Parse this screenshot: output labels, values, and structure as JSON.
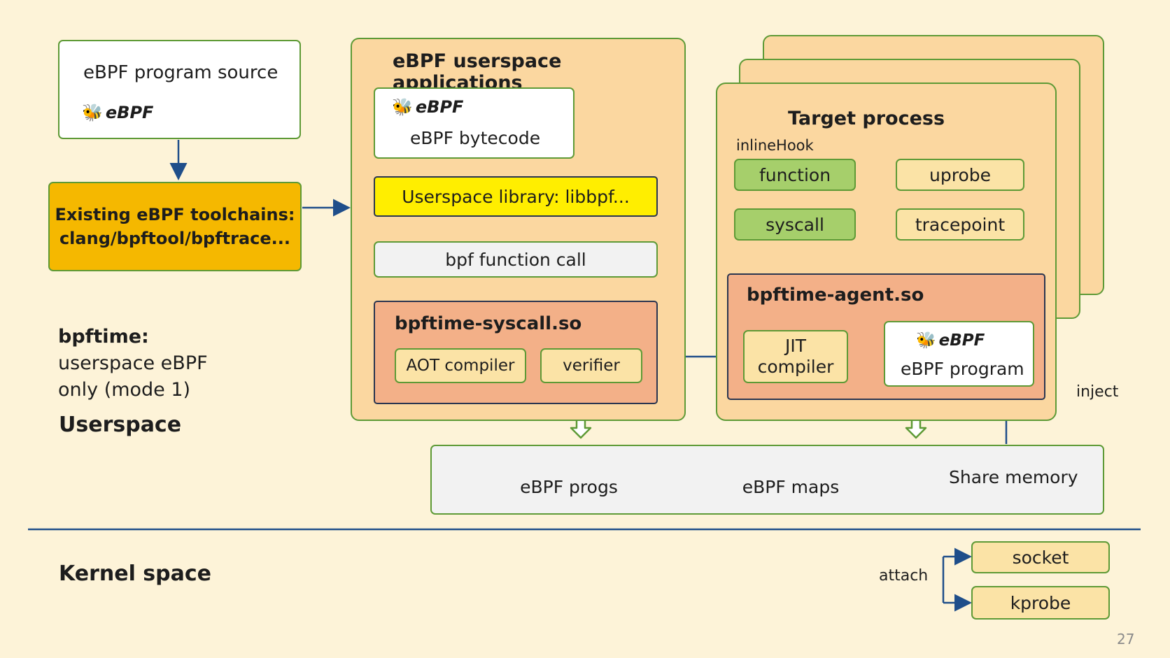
{
  "source": {
    "title": "eBPF program source",
    "logo_text": "eBPF"
  },
  "toolchains": {
    "line1": "Existing eBPF toolchains:",
    "line2": "clang/bpftool/bpftrace..."
  },
  "mode_label": {
    "title": "bpftime:",
    "line1": "userspace eBPF",
    "line2": "only (mode 1)"
  },
  "userspace_label": "Userspace",
  "kernel_label": "Kernel space",
  "apps": {
    "title": "eBPF userspace applications",
    "bytecode_logo": "eBPF",
    "bytecode": "eBPF bytecode",
    "library": "Userspace library: libbpf...",
    "function_call": "bpf function call",
    "syscall_so": "bpftime-syscall.so",
    "aot": "AOT compiler",
    "verifier": "verifier"
  },
  "target": {
    "title": "Target process",
    "inline_hook": "inlineHook",
    "function": "function",
    "uprobe": "uprobe",
    "syscall": "syscall",
    "tracepoint": "tracepoint",
    "agent_so": "bpftime-agent.so",
    "jit_line1": "JIT",
    "jit_line2": "compiler",
    "program_logo": "eBPF",
    "program": "eBPF program"
  },
  "inject_label": "inject",
  "shared": {
    "progs": "eBPF progs",
    "maps": "eBPF maps",
    "label": "Share memory"
  },
  "kernel": {
    "attach": "attach",
    "socket": "socket",
    "kprobe": "kprobe"
  },
  "page_number": "27",
  "colors": {
    "background": "#fdf3d8",
    "border_green": "#5e9a36",
    "arrow_blue": "#1f4e8a",
    "toolchain_orange": "#f5b800",
    "library_yellow": "#ffee00",
    "salmon": "#f3b088"
  },
  "icons": {
    "ebpf_logo": "bee-icon"
  }
}
